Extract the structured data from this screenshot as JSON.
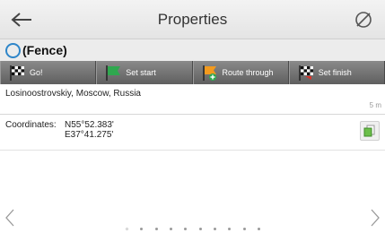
{
  "header": {
    "title": "Properties",
    "back_icon": "arrow-left-icon",
    "right_icon": "gps-off-icon"
  },
  "poi": {
    "name": "(Fence)",
    "icon": "circle-outline-icon",
    "icon_color": "#2f86c9"
  },
  "actions": [
    {
      "label": "Go!",
      "icon": "checkered-flag-icon"
    },
    {
      "label": "Set start",
      "icon": "green-flag-icon"
    },
    {
      "label": "Route through",
      "icon": "orange-flag-plus-icon"
    },
    {
      "label": "Set finish",
      "icon": "checkered-finish-flag-icon"
    }
  ],
  "address": {
    "text": "Losinoostrovskiy, Moscow, Russia",
    "distance": "5 m"
  },
  "coordinates": {
    "label": "Coordinates:",
    "lat": "N55°52.383'",
    "lon": "E37°41.275'",
    "copy_icon": "copy-icon"
  },
  "pager": {
    "page_count": 10,
    "active_index": 0
  },
  "colors": {
    "accent": "#2f86c9",
    "action_bar": "#6f6f6f"
  }
}
